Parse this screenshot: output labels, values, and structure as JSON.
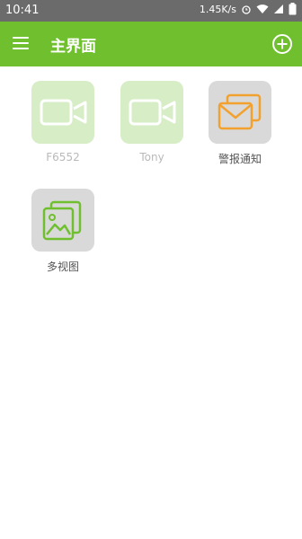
{
  "status_bar": {
    "time": "10:41",
    "speed": "1.45K/s"
  },
  "app_bar": {
    "title": "主界面"
  },
  "icons": {
    "menu": "menu-icon",
    "add": "add-circle-icon",
    "camera": "video-camera-icon",
    "alarm": "envelope-icon",
    "multiview": "image-gallery-icon"
  },
  "colors": {
    "accent": "#6fbf2f",
    "camera_tile": "#d6edc5",
    "gray_tile": "#d9d9d9",
    "orange": "#f2a12e"
  },
  "devices": [
    {
      "label": "F6552"
    },
    {
      "label": "Tony"
    }
  ],
  "shortcuts": [
    {
      "label": "警报通知"
    },
    {
      "label": "多视图"
    }
  ]
}
